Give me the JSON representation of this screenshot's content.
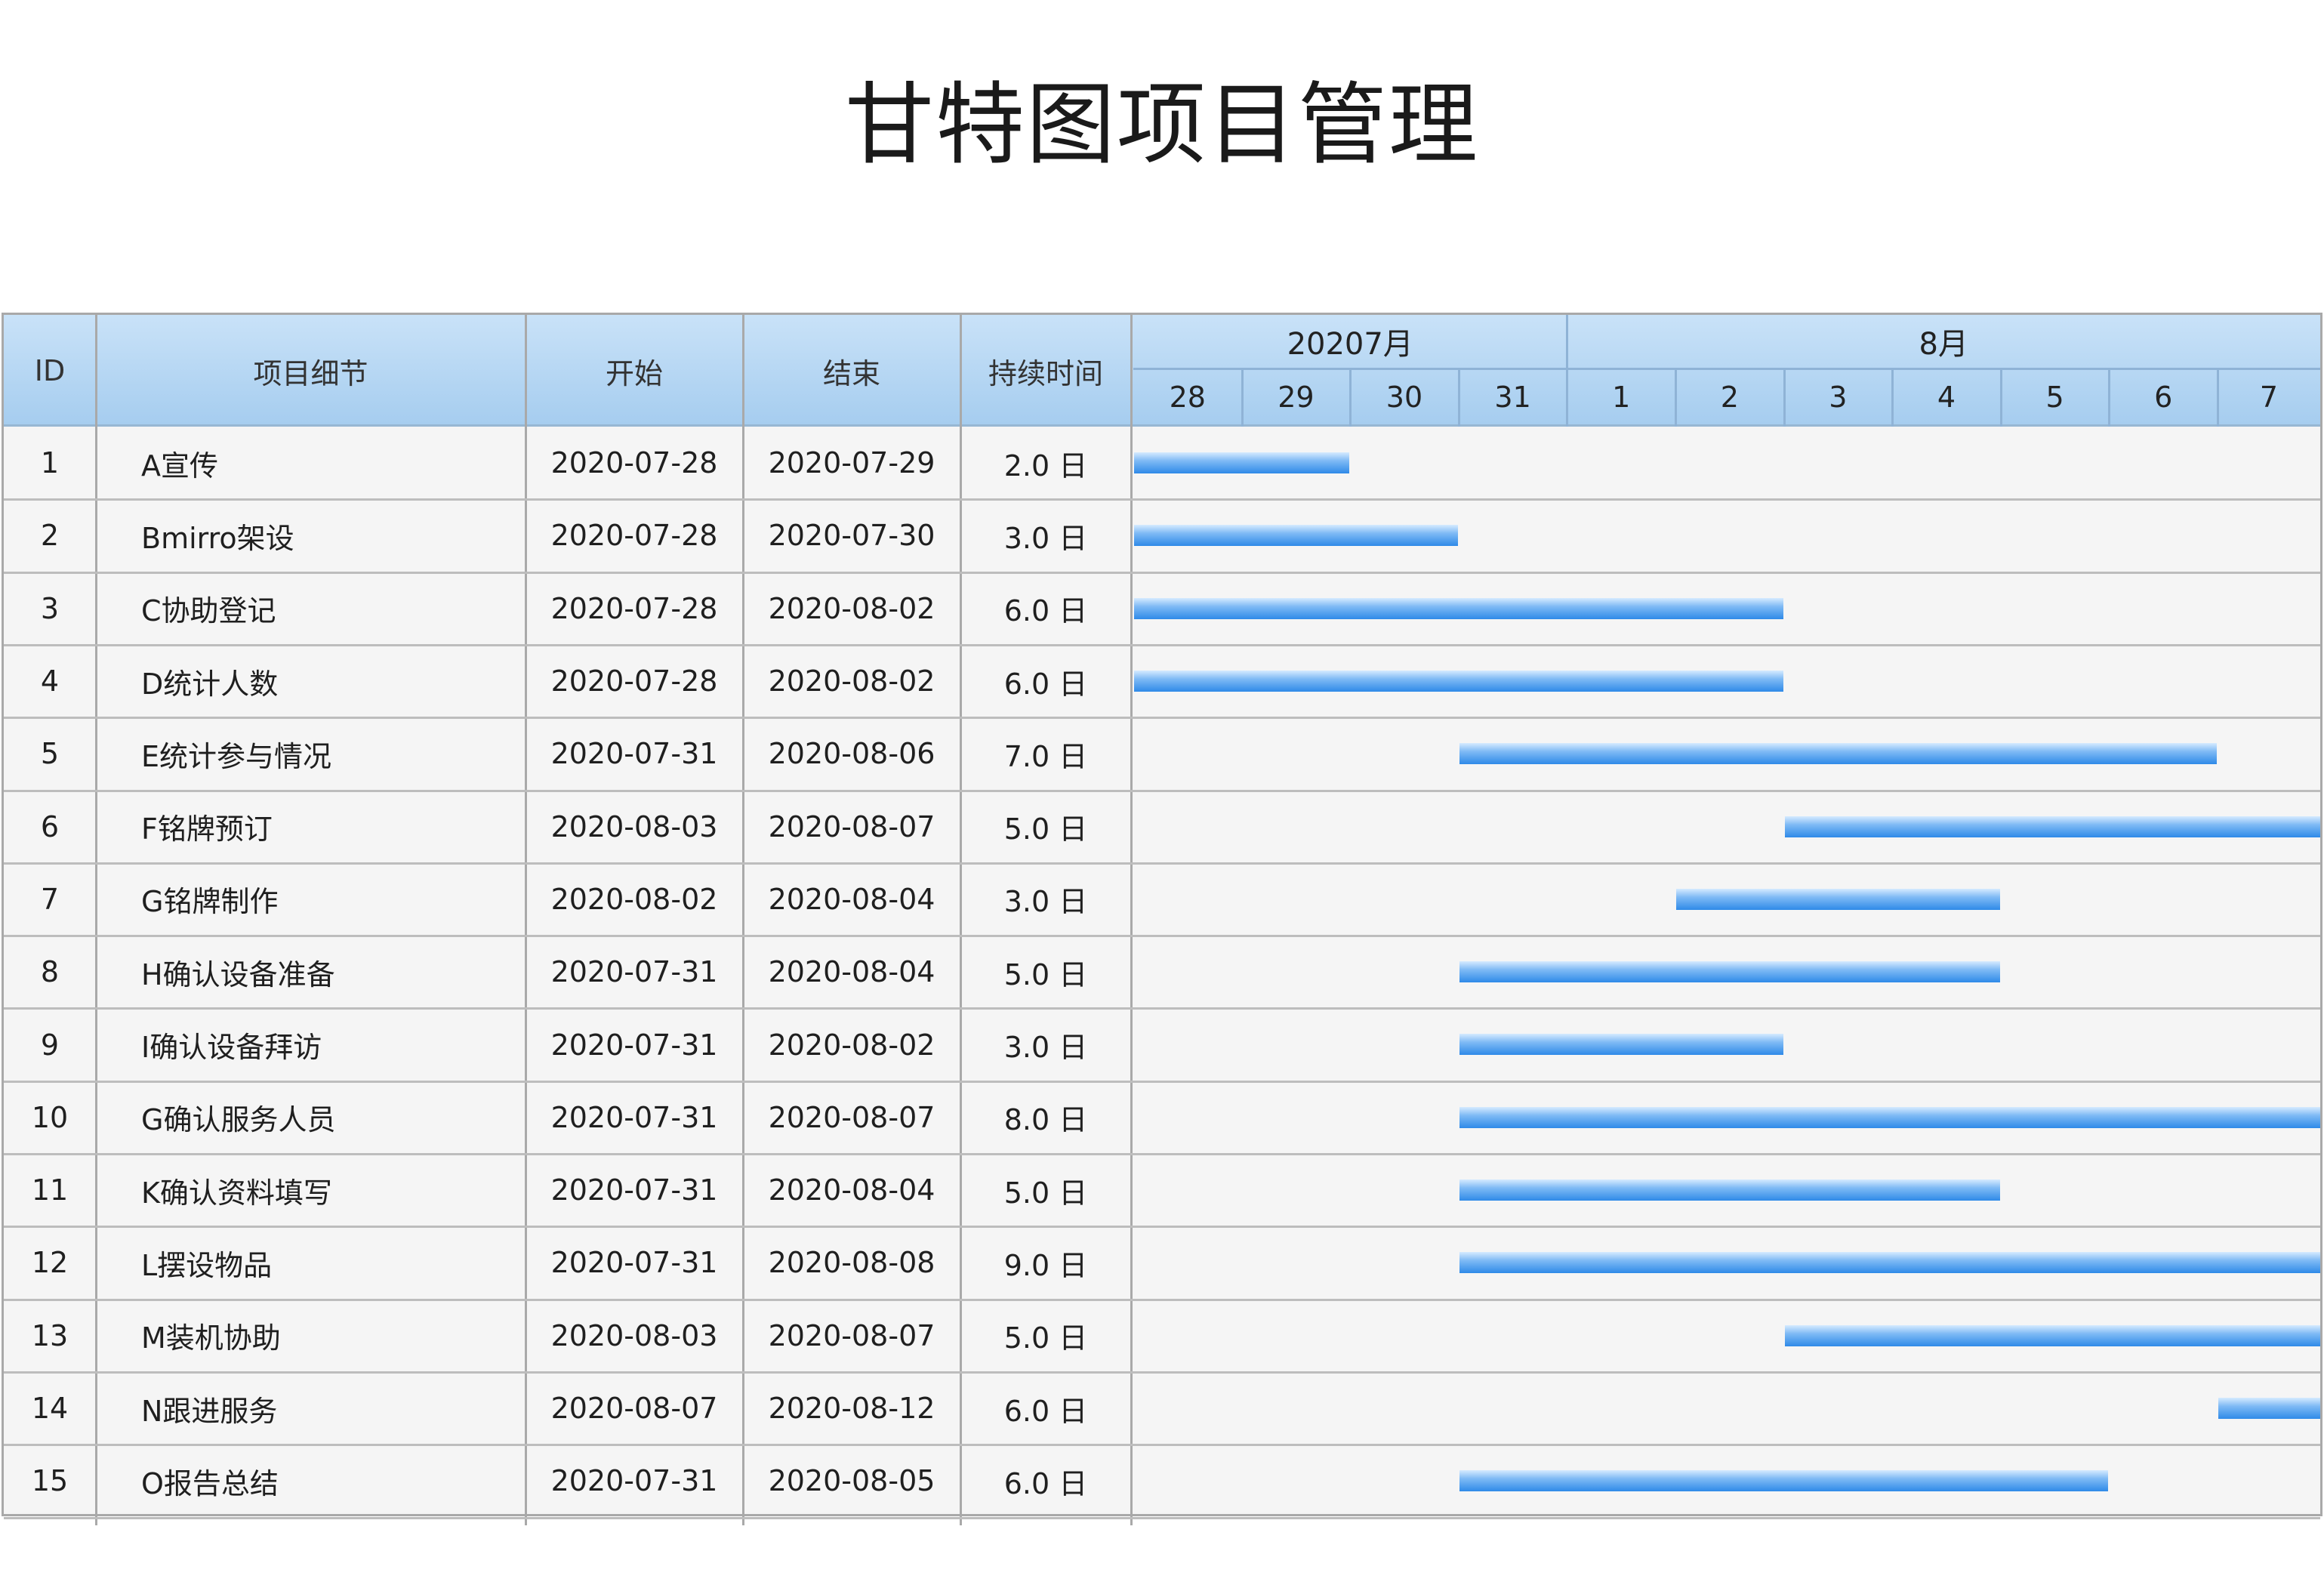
{
  "title": "甘特图项目管理",
  "columns": {
    "id": "ID",
    "detail": "项目细节",
    "start": "开始",
    "end": "结束",
    "duration": "持续时间"
  },
  "months": [
    {
      "label": "20207月",
      "first_day_index": 0,
      "day_count": 4
    },
    {
      "label": "8月",
      "first_day_index": 4,
      "day_count": 7
    }
  ],
  "days": [
    "28",
    "29",
    "30",
    "31",
    "1",
    "2",
    "3",
    "4",
    "5",
    "6",
    "7"
  ],
  "chart_data": {
    "type": "table",
    "timeline_start": "2020-07-28",
    "timeline_end": "2020-08-07",
    "bar_color": "#2f8ae8",
    "header_color": "#a6cdef",
    "tasks": [
      {
        "id": "1",
        "name": "A宣传",
        "start": "2020-07-28",
        "end": "2020-07-29",
        "duration": "2.0 日"
      },
      {
        "id": "2",
        "name": "Bmirro架设",
        "start": "2020-07-28",
        "end": "2020-07-30",
        "duration": "3.0 日"
      },
      {
        "id": "3",
        "name": "C协助登记",
        "start": "2020-07-28",
        "end": "2020-08-02",
        "duration": "6.0 日"
      },
      {
        "id": "4",
        "name": "D统计人数",
        "start": "2020-07-28",
        "end": "2020-08-02",
        "duration": "6.0 日"
      },
      {
        "id": "5",
        "name": "E统计参与情况",
        "start": "2020-07-31",
        "end": "2020-08-06",
        "duration": "7.0 日"
      },
      {
        "id": "6",
        "name": "F铭牌预订",
        "start": "2020-08-03",
        "end": "2020-08-07",
        "duration": "5.0 日"
      },
      {
        "id": "7",
        "name": "G铭牌制作",
        "start": "2020-08-02",
        "end": "2020-08-04",
        "duration": "3.0 日"
      },
      {
        "id": "8",
        "name": "H确认设备准备",
        "start": "2020-07-31",
        "end": "2020-08-04",
        "duration": "5.0 日"
      },
      {
        "id": "9",
        "name": "I确认设备拜访",
        "start": "2020-07-31",
        "end": "2020-08-02",
        "duration": "3.0 日"
      },
      {
        "id": "10",
        "name": "G确认服务人员",
        "start": "2020-07-31",
        "end": "2020-08-07",
        "duration": "8.0 日"
      },
      {
        "id": "11",
        "name": "K确认资料填写",
        "start": "2020-07-31",
        "end": "2020-08-04",
        "duration": "5.0 日"
      },
      {
        "id": "12",
        "name": "L摆设物品",
        "start": "2020-07-31",
        "end": "2020-08-08",
        "duration": "9.0 日"
      },
      {
        "id": "13",
        "name": "M装机协助",
        "start": "2020-08-03",
        "end": "2020-08-07",
        "duration": "5.0 日"
      },
      {
        "id": "14",
        "name": "N跟进服务",
        "start": "2020-08-07",
        "end": "2020-08-12",
        "duration": "6.0 日"
      },
      {
        "id": "15",
        "name": "O报告总结",
        "start": "2020-07-31",
        "end": "2020-08-05",
        "duration": "6.0 日"
      }
    ]
  }
}
